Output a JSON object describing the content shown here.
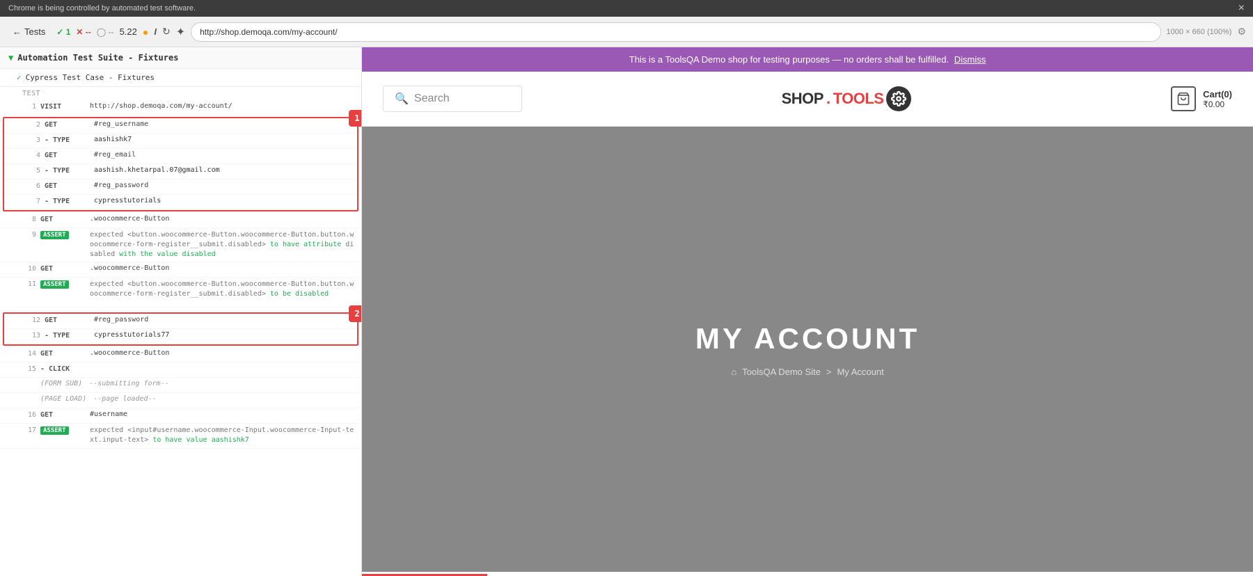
{
  "chrome": {
    "top_bar_text": "Chrome is being controlled by automated test software.",
    "close_btn": "×",
    "toolbar": {
      "back_label": "← Tests",
      "pass_count": "✓ 1",
      "fail_indicator": "✕ --",
      "pending_indicator": "◯ --",
      "version": "5.22",
      "orange_dot": "●",
      "info_icon": "I",
      "reload_icon": "↻",
      "compass_icon": "✦",
      "url": "http://shop.demoqa.com/my-account/",
      "resolution": "1000 × 660  (100%)",
      "settings_icon": "⚙"
    }
  },
  "left_panel": {
    "suite_header": "Automation Test Suite - Fixtures",
    "test_case": "Cypress Test Case - Fixtures",
    "test_label": "TEST",
    "annotation_1": "1",
    "annotation_2": "2",
    "steps": [
      {
        "num": "1",
        "cmd": "VISIT",
        "value": "http://shop.demoqa.com/my-account/",
        "type": "url"
      },
      {
        "num": "2",
        "cmd": "GET",
        "value": "#reg_username",
        "type": "selector",
        "highlighted": true
      },
      {
        "num": "3",
        "cmd": "- TYPE",
        "value": "aashishk7",
        "type": "string",
        "highlighted": true
      },
      {
        "num": "4",
        "cmd": "GET",
        "value": "#reg_email",
        "type": "selector",
        "highlighted": true
      },
      {
        "num": "5",
        "cmd": "- TYPE",
        "value": "aashish.khetarpal.07@gmail.com",
        "type": "string",
        "highlighted": true
      },
      {
        "num": "6",
        "cmd": "GET",
        "value": "#reg_password",
        "type": "selector",
        "highlighted": true
      },
      {
        "num": "7",
        "cmd": "- TYPE",
        "value": "cypresstutorials",
        "type": "string",
        "highlighted": true
      },
      {
        "num": "8",
        "cmd": "GET",
        "value": ".woocommerce-Button",
        "type": "selector"
      },
      {
        "num": "9",
        "cmd": "ASSERT",
        "value": "expected <button.woocommerce-Button.woocommerce-Button.button.woocommerce-form-register__submit.disabled> to have attribute disabled with the value disabled",
        "type": "expected"
      },
      {
        "num": "10",
        "cmd": "GET",
        "value": ".woocommerce-Button",
        "type": "selector"
      },
      {
        "num": "11",
        "cmd": "ASSERT",
        "value": "expected <button.woocommerce-Button.woocommerce-Button.button.woocommerce-form-register__submit.disabled> to be disabled",
        "type": "expected"
      },
      {
        "num": "12",
        "cmd": "GET",
        "value": "#reg_password",
        "type": "selector",
        "highlighted2": true
      },
      {
        "num": "13",
        "cmd": "- TYPE",
        "value": "cypresstutorials77",
        "type": "string",
        "highlighted2": true
      },
      {
        "num": "14",
        "cmd": "GET",
        "value": ".woocommerce-Button",
        "type": "selector"
      },
      {
        "num": "15",
        "cmd": "- CLICK",
        "value": "",
        "type": "string"
      },
      {
        "num": "",
        "cmd": "(FORM SUB)",
        "value": "--submitting form--",
        "type": "italic"
      },
      {
        "num": "",
        "cmd": "(PAGE LOAD)",
        "value": "--page loaded--",
        "type": "italic"
      },
      {
        "num": "16",
        "cmd": "GET",
        "value": "#username",
        "type": "selector"
      },
      {
        "num": "17",
        "cmd": "ASSERT",
        "value": "expected <input#username.woocommerce-Input.woocommerce-Input-text.input-text> to have value aashishk7",
        "type": "expected"
      }
    ]
  },
  "right_panel": {
    "demo_banner": "This is a ToolsQA Demo shop for testing purposes — no orders shall be fulfilled.",
    "dismiss_link": "Dismiss",
    "search_placeholder": "Search",
    "logo_shop": "SHOP.",
    "logo_tools": "TOOLS",
    "cart_label": "Cart(0)",
    "cart_price": "₹0.00",
    "hero_title": "MY ACCOUNT",
    "breadcrumb_home": "⌂",
    "breadcrumb_site": "ToolsQA Demo Site",
    "breadcrumb_sep": ">",
    "breadcrumb_page": "My Account"
  }
}
